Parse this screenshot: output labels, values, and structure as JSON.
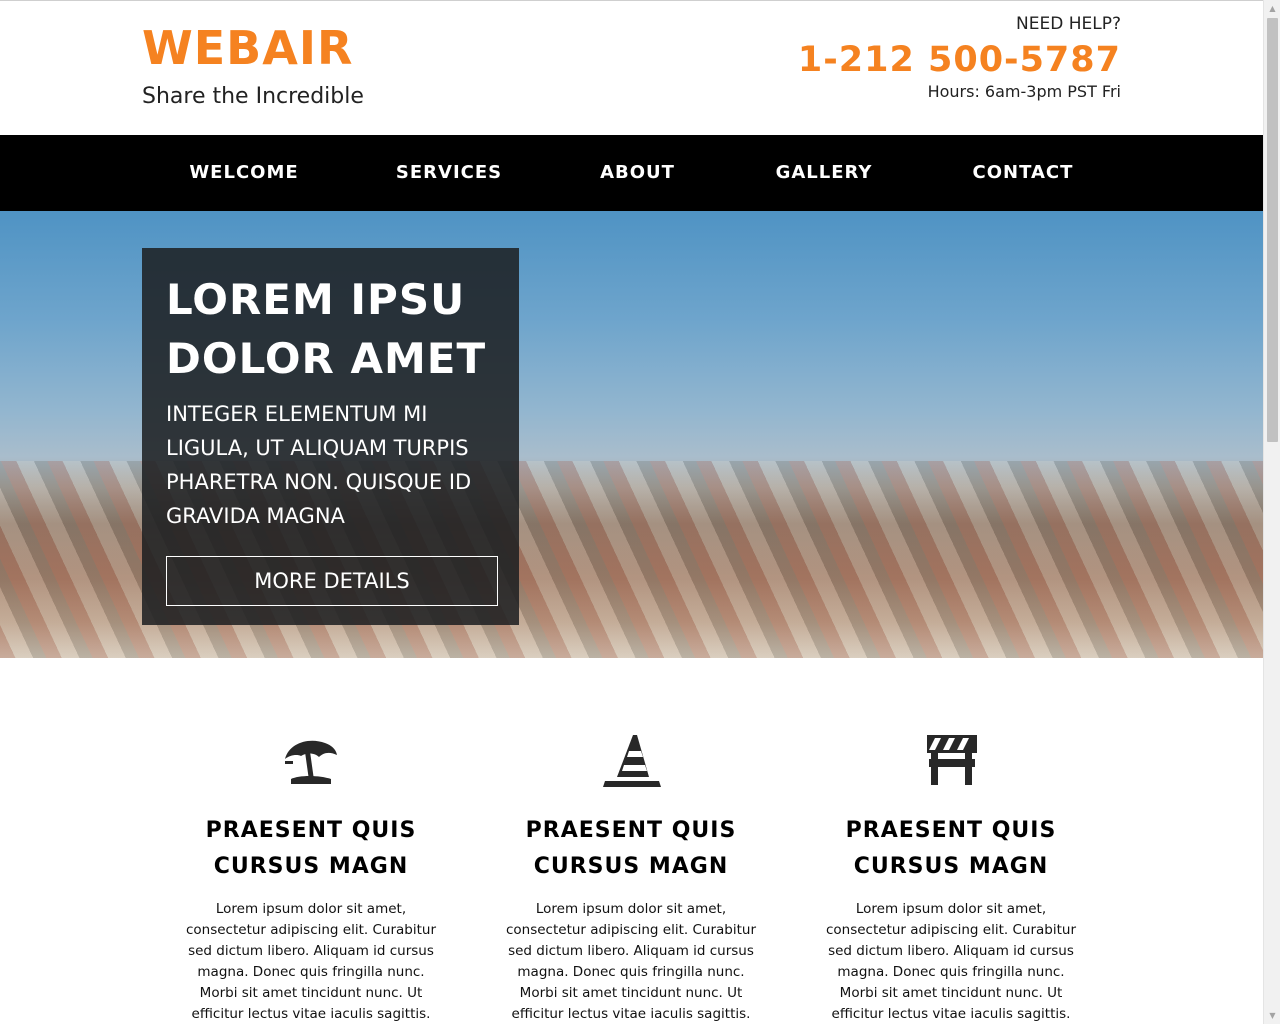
{
  "header": {
    "logo": "WEBAIR",
    "tagline": "Share the Incredible",
    "help_label": "NEED HELP?",
    "phone": "1-212 500-5787",
    "hours": "Hours: 6am-3pm PST Fri"
  },
  "nav": {
    "items": [
      "WELCOME",
      "SERVICES",
      "ABOUT",
      "GALLERY",
      "CONTACT"
    ]
  },
  "hero": {
    "title": "LOREM IPSU DOLOR AMET",
    "text": "INTEGER ELEMENTUM MI LIGULA, UT ALIQUAM TURPIS PHARETRA NON. QUISQUE ID GRAVIDA MAGNA",
    "button_label": "MORE DETAILS"
  },
  "features": [
    {
      "icon": "umbrella-icon",
      "title": "PRAESENT QUIS CURSUS MAGN",
      "text": "Lorem ipsum dolor sit amet, consectetur adipiscing elit. Curabitur sed dictum libero. Aliquam id cursus magna. Donec quis fringilla nunc. Morbi sit amet tincidunt nunc. Ut efficitur lectus vitae iaculis sagittis. Vivamus sed sem eu"
    },
    {
      "icon": "traffic-cone-icon",
      "title": "PRAESENT QUIS CURSUS MAGN",
      "text": "Lorem ipsum dolor sit amet, consectetur adipiscing elit. Curabitur sed dictum libero. Aliquam id cursus magna. Donec quis fringilla nunc. Morbi sit amet tincidunt nunc. Ut efficitur lectus vitae iaculis sagittis. Vivamus sed sem eu"
    },
    {
      "icon": "barricade-icon",
      "title": "PRAESENT QUIS CURSUS MAGN",
      "text": "Lorem ipsum dolor sit amet, consectetur adipiscing elit. Curabitur sed dictum libero. Aliquam id cursus magna. Donec quis fringilla nunc. Morbi sit amet tincidunt nunc. Ut efficitur lectus vitae iaculis sagittis. Vivamus sed sem eu"
    }
  ],
  "colors": {
    "brand": "#f58220",
    "nav_bg": "#000000",
    "hero_box": "#1c1e21"
  }
}
